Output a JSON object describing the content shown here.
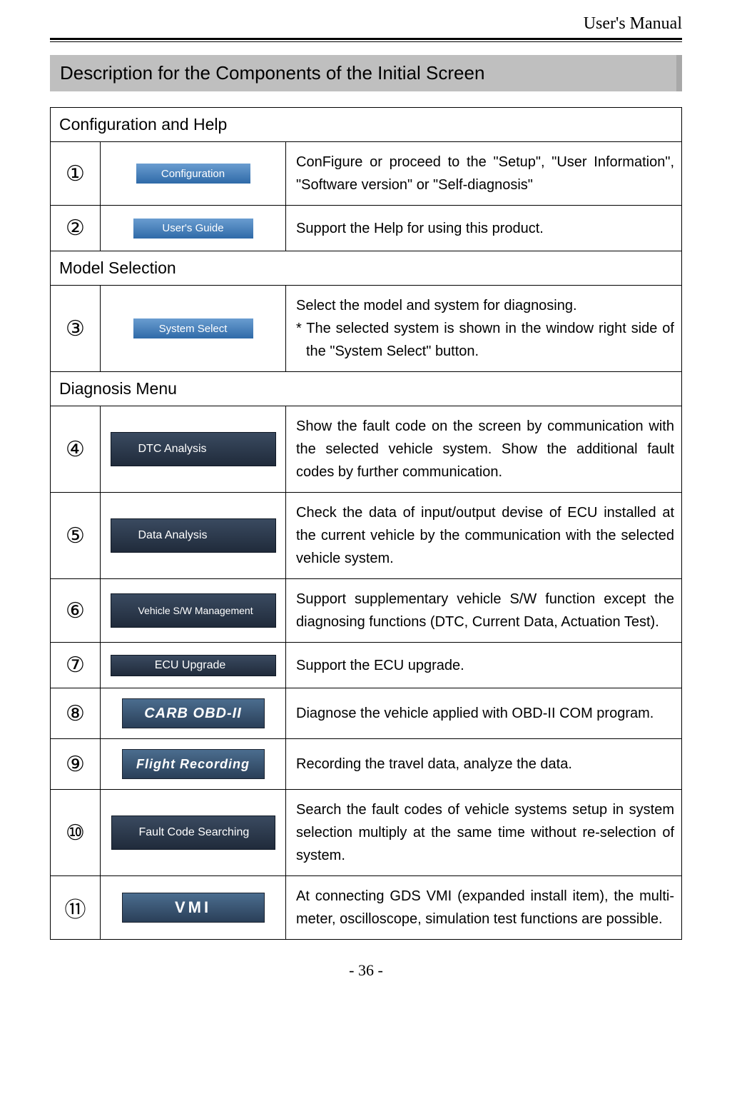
{
  "header": {
    "title": "User's Manual"
  },
  "main_heading": "Description for the Components of the Initial Screen",
  "sections": {
    "config": "Configuration and Help",
    "model": "Model Selection",
    "diag": "Diagnosis Menu"
  },
  "items": {
    "i1": {
      "num": "①",
      "btn": "Configuration",
      "desc": "ConFigure or proceed to the \"Setup\", \"User Information\", \"Software version\" or \"Self-diagnosis\""
    },
    "i2": {
      "num": "②",
      "btn": "User's Guide",
      "desc": "Support the Help for using this product."
    },
    "i3": {
      "num": "③",
      "btn": "System Select",
      "desc": "Select the model and system for diagnosing.",
      "note": "* The selected system is shown in the window right side of the \"System Select\" button."
    },
    "i4": {
      "num": "④",
      "btn": "DTC Analysis",
      "desc": "Show the fault code on the screen by communication with the selected vehicle system. Show the additional fault codes by further communication."
    },
    "i5": {
      "num": "⑤",
      "btn": "Data Analysis",
      "desc": "Check the data of input/output devise of ECU installed at the current vehicle by the communication with the selected vehicle system."
    },
    "i6": {
      "num": "⑥",
      "btn": "Vehicle S/W Management",
      "desc": "Support supplementary vehicle S/W function except the diagnosing functions (DTC, Current Data, Actuation Test)."
    },
    "i7": {
      "num": "⑦",
      "btn": "ECU Upgrade",
      "desc": "Support the ECU upgrade."
    },
    "i8": {
      "num": "⑧",
      "btn": "CARB OBD-II",
      "desc": "Diagnose the vehicle applied with OBD-II COM program."
    },
    "i9": {
      "num": "⑨",
      "btn": "Flight Recording",
      "desc": "Recording the travel data, analyze the data."
    },
    "i10": {
      "num": "⑩",
      "btn": "Fault Code Searching",
      "desc": "Search the fault codes of vehicle systems setup in system selection multiply at the same time without re-selection of system."
    },
    "i11": {
      "num": "⑪",
      "btn": "VMI",
      "desc": "At connecting GDS VMI (expanded install item), the multi-meter, oscilloscope, simulation test functions are possible."
    }
  },
  "footer": "- 36 -"
}
